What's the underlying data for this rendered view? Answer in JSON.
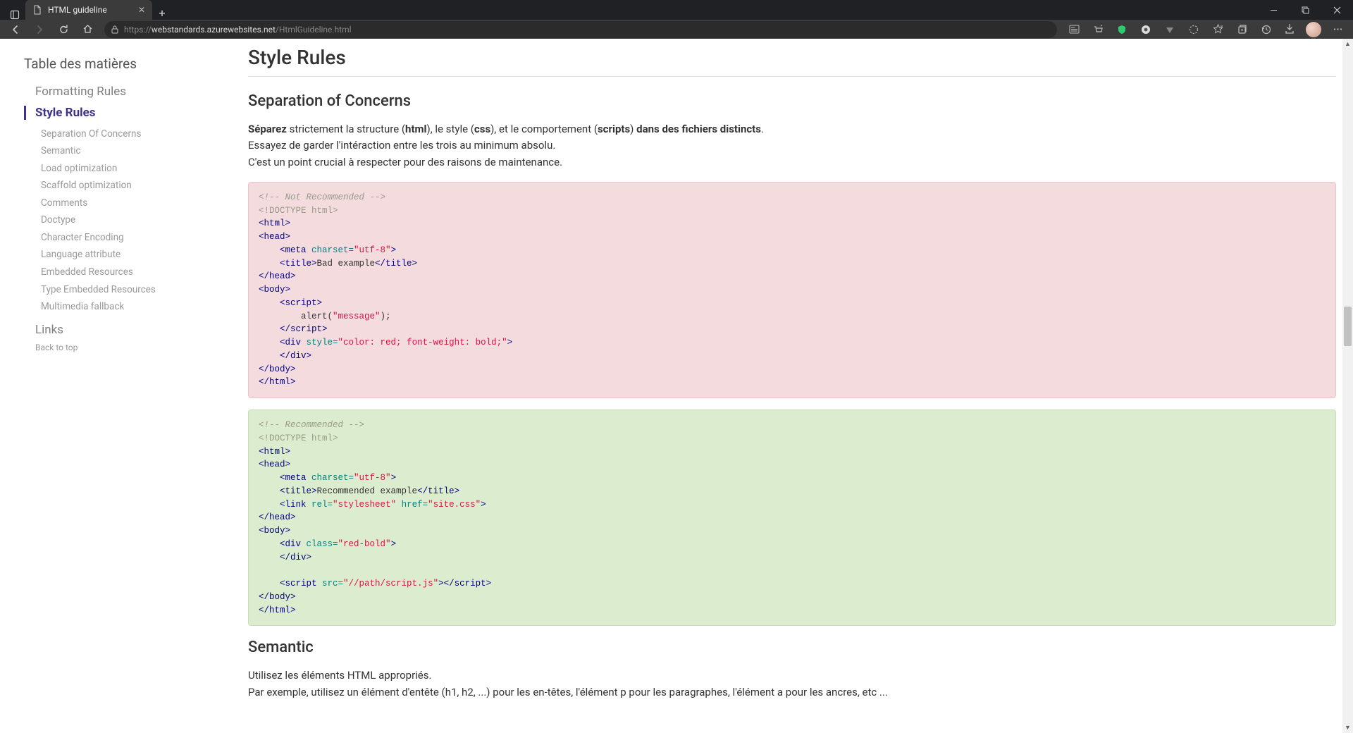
{
  "browser": {
    "tab_title": "HTML guideline",
    "url_host": "webstandards.azurewebsites.net",
    "url_path": "/HtmlGuideline.html"
  },
  "toc": {
    "title": "Table des matières",
    "section1": "Formatting Rules",
    "section2": "Style Rules",
    "items": [
      "Separation Of Concerns",
      "Semantic",
      "Load optimization",
      "Scaffold optimization",
      "Comments",
      "Doctype",
      "Character Encoding",
      "Language attribute",
      "Embedded Resources",
      "Type Embedded Resources",
      "Multimedia fallback"
    ],
    "section3": "Links",
    "back": "Back to top"
  },
  "content": {
    "h1": "Style Rules",
    "soc": {
      "heading": "Separation of Concerns",
      "p1_strong1": "Séparez",
      "p1_t1": " strictement la structure (",
      "p1_b1": "html",
      "p1_t2": "), le style (",
      "p1_b2": "css",
      "p1_t3": "), et le comportement (",
      "p1_b3": "scripts",
      "p1_t4": ") ",
      "p1_strong2": "dans des fichiers distincts",
      "p1_t5": ".",
      "p2": "Essayez de garder l'intéraction entre les trois au minimum absolu.",
      "p3": "C'est un point crucial à respecter pour des raisons de maintenance."
    },
    "code_bad": {
      "c1": "<!-- Not Recommended -->",
      "l2a": "<!DOCTYPE html>",
      "l3": "<html>",
      "l4": "<head>",
      "l5_tag": "<meta",
      "l5_attr": " charset=",
      "l5_str": "\"utf-8\"",
      "l5_end": ">",
      "l6_open": "<title>",
      "l6_text": "Bad example",
      "l6_close": "</title>",
      "l7": "</head>",
      "l8": "<body>",
      "l9": "<script>",
      "l10a": "alert(",
      "l10b": "\"message\"",
      "l10c": ");",
      "l11": "</script>",
      "l12_tag": "<div",
      "l12_attr": " style=",
      "l12_str": "\"color: red; font-weight: bold;\"",
      "l12_end": ">",
      "l13": "</div>",
      "l14": "</body>",
      "l15": "</html>"
    },
    "code_good": {
      "c1": "<!-- Recommended -->",
      "l2a": "<!DOCTYPE html>",
      "l3": "<html>",
      "l4": "<head>",
      "l5_tag": "<meta",
      "l5_attr": " charset=",
      "l5_str": "\"utf-8\"",
      "l5_end": ">",
      "l6_open": "<title>",
      "l6_text": "Recommended example",
      "l6_close": "</title>",
      "l7_tag": "<link",
      "l7_attr1": " rel=",
      "l7_str1": "\"stylesheet\"",
      "l7_attr2": " href=",
      "l7_str2": "\"site.css\"",
      "l7_end": ">",
      "l8": "</head>",
      "l9": "<body>",
      "l10_tag": "<div",
      "l10_attr": " class=",
      "l10_str": "\"red-bold\"",
      "l10_end": ">",
      "l11": "</div>",
      "l13_tag": "<script",
      "l13_attr": " src=",
      "l13_str": "\"//path/script.js\"",
      "l13_end": ">",
      "l13_close": "</script>",
      "l14": "</body>",
      "l15": "</html>"
    },
    "semantic": {
      "heading": "Semantic",
      "p1": "Utilisez les éléments HTML appropriés.",
      "p2": "Par exemple, utilisez un élément d'entête (h1, h2, ...) pour les en-têtes, l'élément p pour les paragraphes, l'élément a pour les ancres, etc ..."
    }
  }
}
